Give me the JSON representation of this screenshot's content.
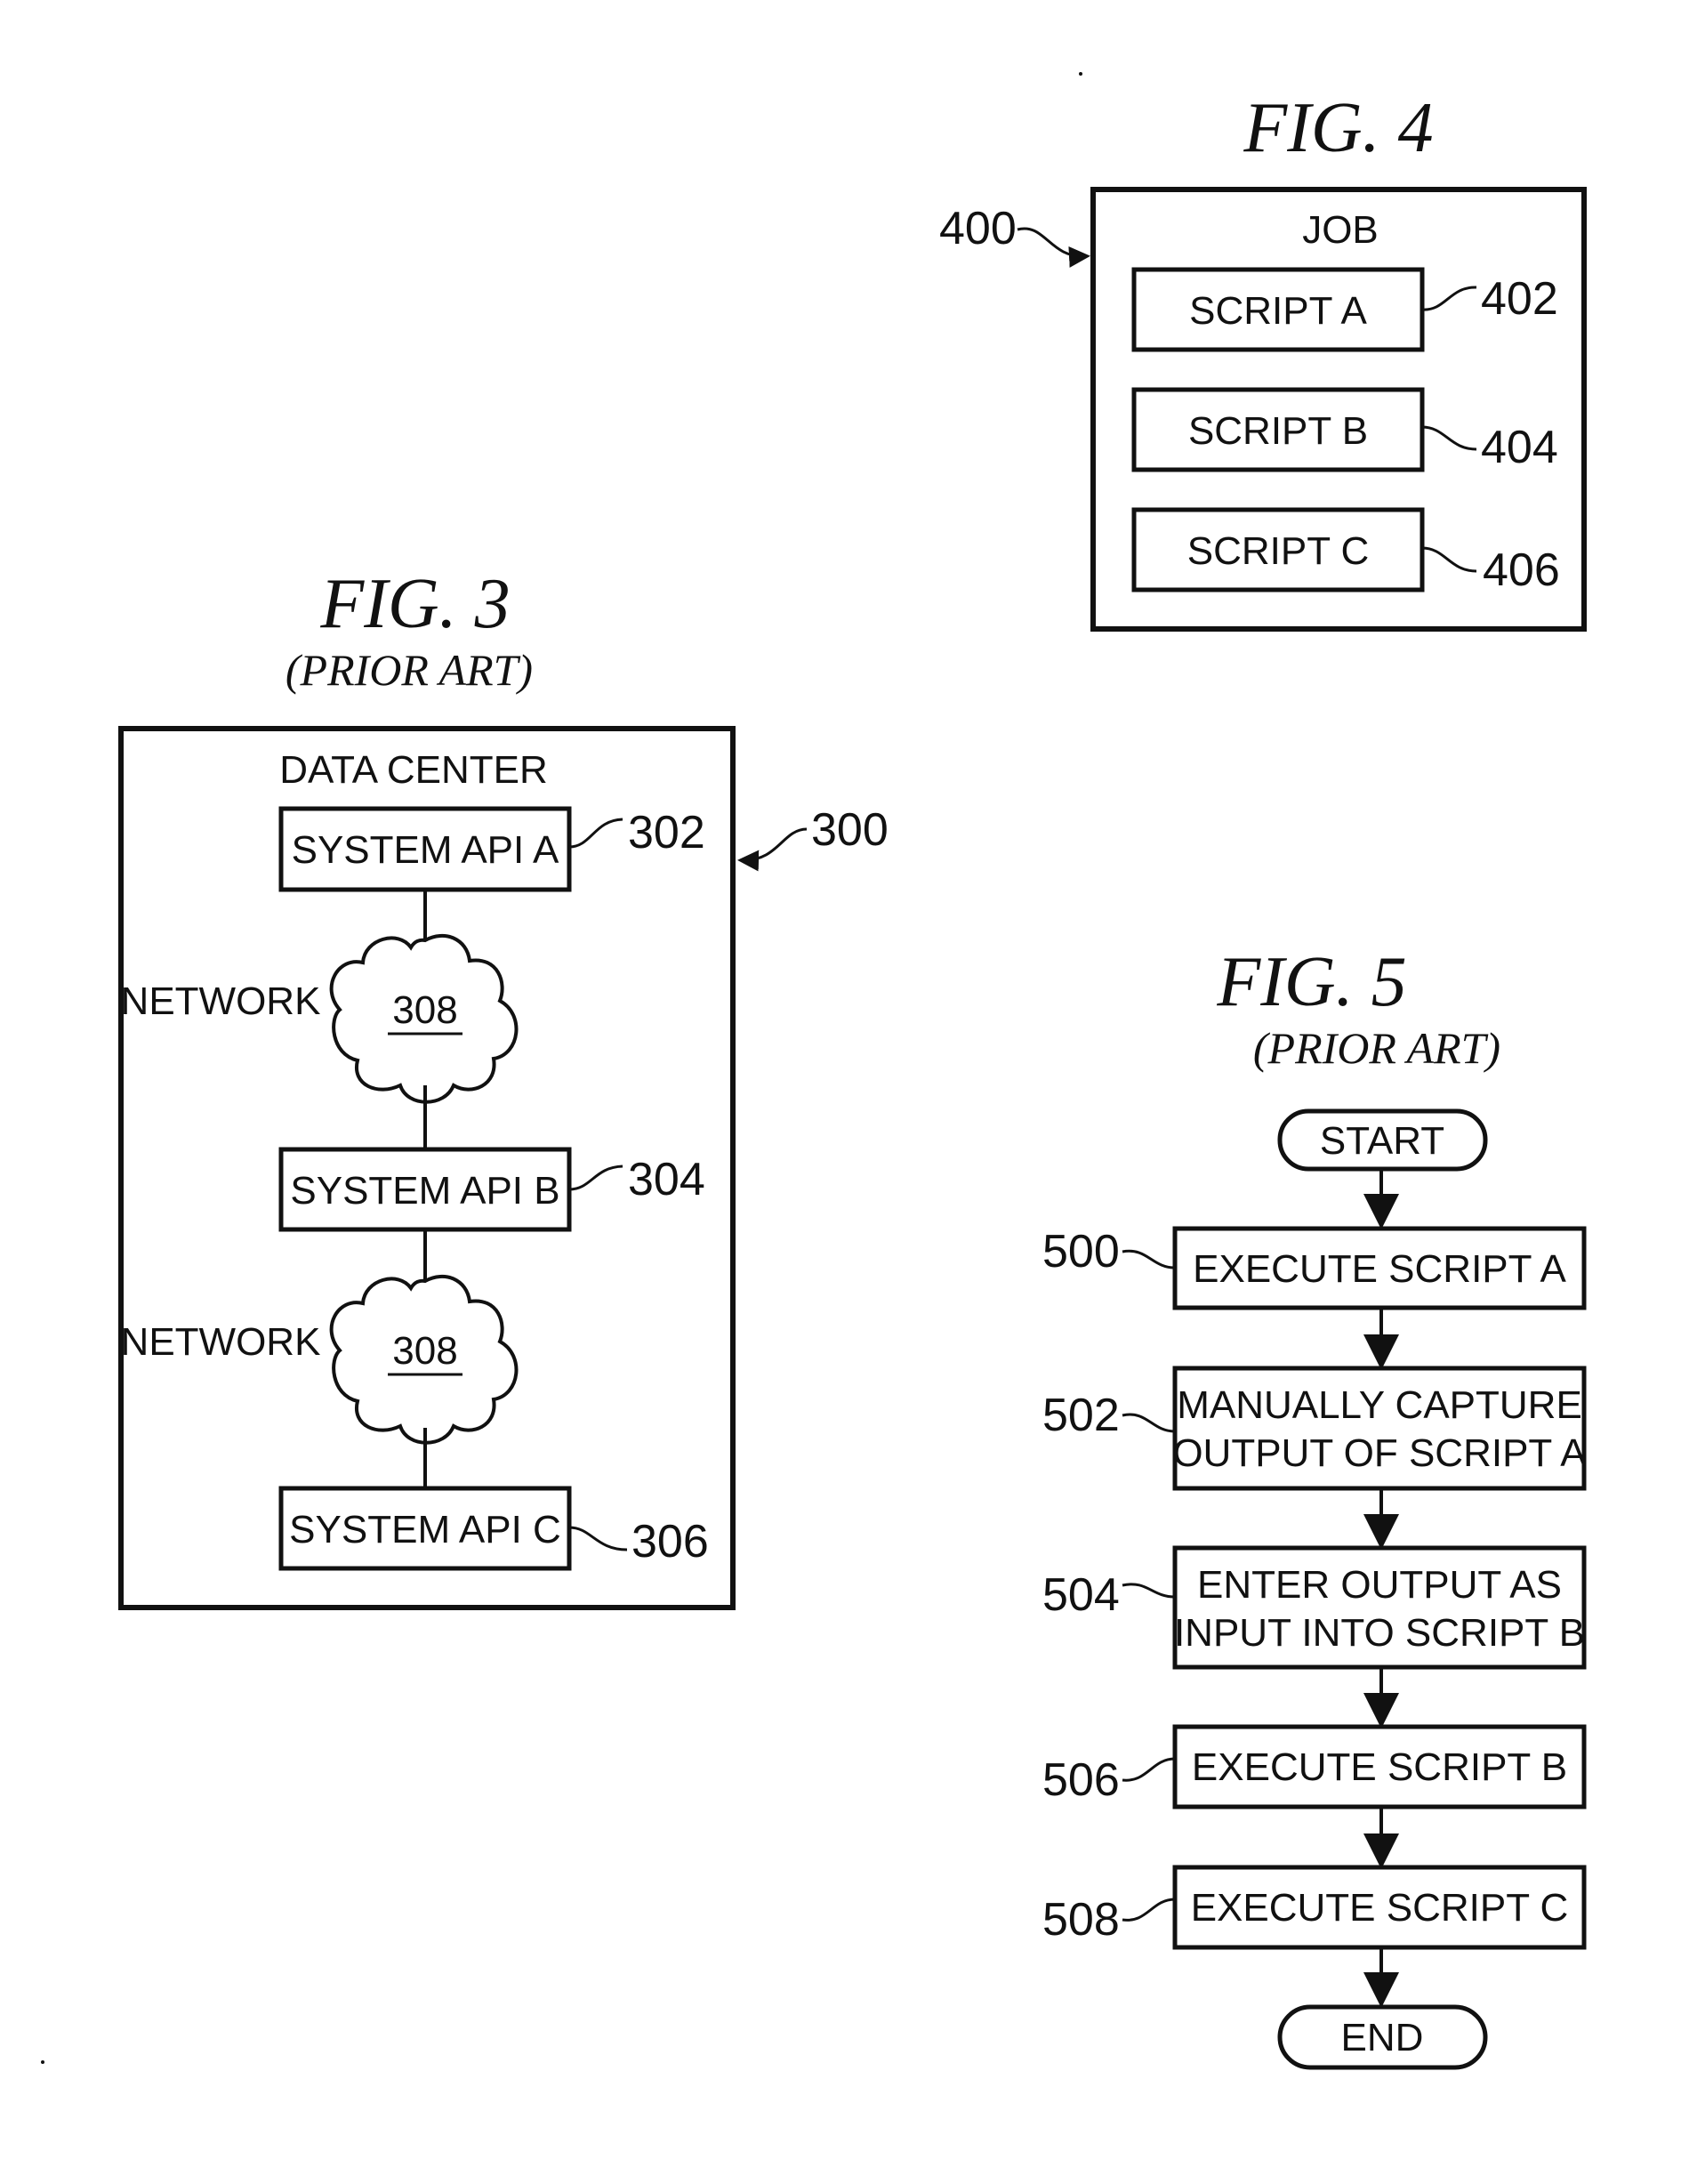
{
  "fig4": {
    "title": "FIG. 4",
    "ref": "400",
    "container_label": "JOB",
    "items": [
      {
        "label": "SCRIPT A",
        "ref": "402"
      },
      {
        "label": "SCRIPT B",
        "ref": "404"
      },
      {
        "label": "SCRIPT C",
        "ref": "406"
      }
    ]
  },
  "fig3": {
    "title": "FIG. 3",
    "subtitle": "(PRIOR ART)",
    "ref": "300",
    "container_label": "DATA CENTER",
    "systems": [
      {
        "label": "SYSTEM API A",
        "ref": "302"
      },
      {
        "label": "SYSTEM API B",
        "ref": "304"
      },
      {
        "label": "SYSTEM API C",
        "ref": "306"
      }
    ],
    "networks": [
      {
        "label": "NETWORK",
        "ref": "308"
      },
      {
        "label": "NETWORK",
        "ref": "308"
      }
    ]
  },
  "fig5": {
    "title": "FIG. 5",
    "subtitle": "(PRIOR ART)",
    "start": "START",
    "end": "END",
    "steps": [
      {
        "ref": "500",
        "lines": [
          "EXECUTE SCRIPT A"
        ]
      },
      {
        "ref": "502",
        "lines": [
          "MANUALLY CAPTURE",
          "OUTPUT OF SCRIPT A"
        ]
      },
      {
        "ref": "504",
        "lines": [
          "ENTER OUTPUT AS",
          "INPUT INTO SCRIPT B"
        ]
      },
      {
        "ref": "506",
        "lines": [
          "EXECUTE SCRIPT B"
        ]
      },
      {
        "ref": "508",
        "lines": [
          "EXECUTE SCRIPT C"
        ]
      }
    ]
  }
}
